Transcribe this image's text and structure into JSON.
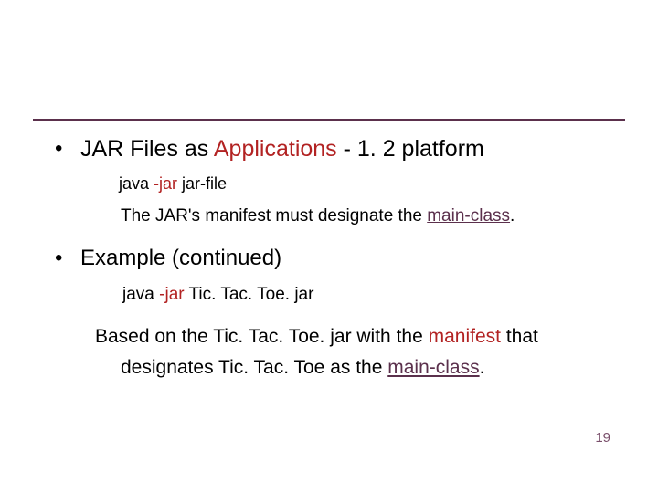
{
  "bullets": {
    "b1": {
      "marker": "•",
      "pre": "JAR Files as ",
      "emph": "Applications",
      "post": " - 1. 2 platform"
    },
    "sub1": {
      "pre": "java ",
      "flag": "-jar",
      "post": " jar-file"
    },
    "sub2": {
      "pre": "The JAR's manifest must designate the ",
      "emph": "main-class",
      "post": "."
    },
    "b2": {
      "marker": "•",
      "text": "Example (continued)"
    },
    "sub3": {
      "pre": "java ",
      "flag": "-jar",
      "post": " Tic. Tac. Toe. jar"
    },
    "para": {
      "line1_pre": "Based on the Tic. Tac. Toe. jar with the ",
      "line1_emph": "manifest",
      "line1_post": " that",
      "line2_pre": "designates Tic. Tac. Toe as the ",
      "line2_emph": "main-class",
      "line2_post": "."
    }
  },
  "page_number": "19"
}
